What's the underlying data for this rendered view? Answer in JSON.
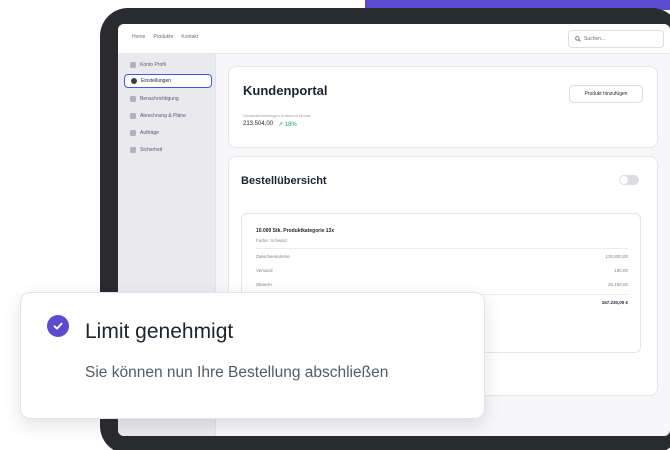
{
  "colors": {
    "accent": "#5b4bd1",
    "success": "#17a673",
    "active_border": "#3f5bd8"
  },
  "topnav": {
    "links": [
      "Home",
      "Produkte",
      "Kontakt"
    ],
    "search_placeholder": "Suchen..."
  },
  "sidebar": {
    "items": [
      {
        "label": "Konto Profil",
        "icon": "user-icon"
      },
      {
        "label": "Einstellungen",
        "icon": "gear-icon",
        "active": true
      },
      {
        "label": "Benachrichtigung",
        "icon": "bell-icon"
      },
      {
        "label": "Abrechnung & Pläne",
        "icon": "card-icon"
      },
      {
        "label": "Aufträge",
        "icon": "orders-icon"
      },
      {
        "label": "Sicherheit",
        "icon": "shield-icon"
      }
    ]
  },
  "portal": {
    "title": "Kundenportal",
    "add_button": "Produkt hinzufügen",
    "stat_label": "Gesamtbestellungen in diesem Monat",
    "stat_value": "213.504,00",
    "stat_change": "↗ 18%"
  },
  "orders": {
    "title": "Bestellübersicht",
    "toggle_on": false,
    "product_name": "10.000 Stk. Produktkategorie 13x",
    "product_color": "Farbe: Schwarz",
    "rows": [
      {
        "label": "Zwischensumme",
        "value": "130.800,00"
      },
      {
        "label": "Versand",
        "value": "190,00"
      },
      {
        "label": "Steuern",
        "value": "26.180,00"
      }
    ],
    "total": "157.230,00 €"
  },
  "toast": {
    "title": "Limit genehmigt",
    "body": "Sie können nun Ihre Bestellung abschließen",
    "icon": "check-circle-icon"
  }
}
